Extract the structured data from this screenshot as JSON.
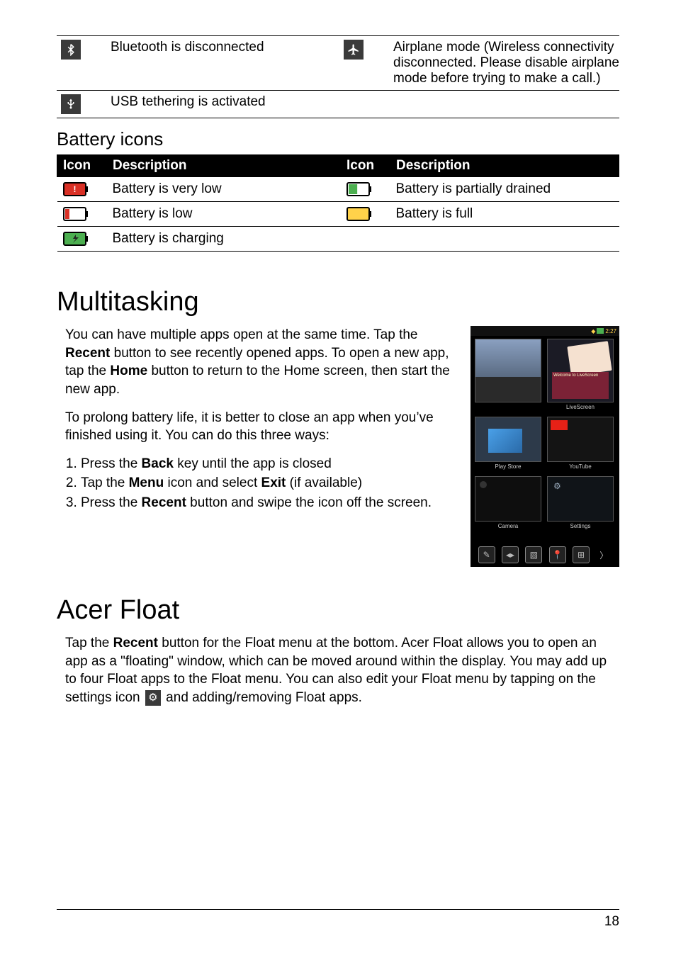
{
  "top_rows": [
    {
      "icon1_name": "bluetooth-disconnected-icon",
      "icon1_glyph": "⟡",
      "desc1": "Bluetooth is disconnected",
      "icon2_name": "airplane-mode-icon",
      "icon2_glyph": "✈",
      "desc2": "Airplane mode (Wireless connectivity disconnected. Please disable airplane mode before trying to make a call.)"
    },
    {
      "icon1_name": "usb-tethering-icon",
      "icon1_glyph": "Ψ",
      "desc1": "USB tethering is activated",
      "icon2_name": "",
      "icon2_glyph": "",
      "desc2": ""
    }
  ],
  "battery_heading": "Battery icons",
  "battery_table": {
    "headers": [
      "Icon",
      "Description",
      "Icon",
      "Description"
    ],
    "rows": [
      {
        "icon1": {
          "name": "battery-very-low-icon",
          "fill": "#d93025",
          "level": 0.15,
          "bang": true,
          "body": "#d93025"
        },
        "desc1": "Battery is very low",
        "icon2": {
          "name": "battery-partial-icon",
          "fill": "#4caf50",
          "level": 0.45,
          "bang": false,
          "body": "#fff"
        },
        "desc2": "Battery is partially drained"
      },
      {
        "icon1": {
          "name": "battery-low-icon",
          "fill": "#d93025",
          "level": 0.22,
          "bang": false,
          "body": "#fff"
        },
        "desc1": "Battery is low",
        "icon2": {
          "name": "battery-full-icon",
          "fill": "#ffd24a",
          "level": 1.0,
          "bang": false,
          "body": "#ffd24a"
        },
        "desc2": "Battery is full"
      },
      {
        "icon1": {
          "name": "battery-charging-icon",
          "fill": "#4caf50",
          "level": 1.0,
          "bang": false,
          "body": "#4caf50",
          "bolt": true
        },
        "desc1": "Battery is charging",
        "icon2": null,
        "desc2": ""
      }
    ]
  },
  "multitasking": {
    "heading": "Multitasking",
    "p1_pre": "You can have multiple apps open at the same time. Tap the ",
    "p1_b1": "Recent",
    "p1_mid": " button to see recently opened apps. To open a new app, tap the ",
    "p1_b2": "Home",
    "p1_post": " button to return to the Home screen, then start the new app.",
    "p2": "To prolong battery life, it is better to close an app when you’ve finished using it. You can do this three ways:",
    "li1_pre": "Press the ",
    "li1_b": "Back",
    "li1_post": " key until the app is closed",
    "li2_pre": "Tap the ",
    "li2_b1": "Menu",
    "li2_mid": " icon and select ",
    "li2_b2": "Exit",
    "li2_post": " (if available)",
    "li3_pre": "Press the ",
    "li3_b": "Recent",
    "li3_post": " button and swipe the icon off the screen."
  },
  "acer_float": {
    "heading": "Acer Float",
    "p1_pre": "Tap the ",
    "p1_b": "Recent",
    "p1_post": " button for the Float menu at the bottom. Acer Float allows you to open an app as a \"floating\" window, which can be moved around within the display. You may add up to four Float apps to the Float menu. You can also edit your Float menu by tapping on the settings icon ",
    "p1_after_gear": " and adding/removing Float apps."
  },
  "phone": {
    "time": "2:27",
    "labels": {
      "livescreen": "LiveScreen",
      "playstore": "Play Store",
      "youtube": "YouTube",
      "camera": "Camera",
      "settings": "Settings"
    }
  },
  "page_number": "18"
}
